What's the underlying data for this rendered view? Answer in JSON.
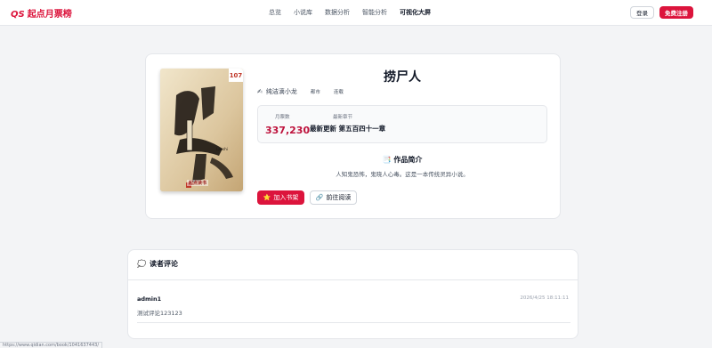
{
  "header": {
    "logo_mark": "QS",
    "logo_text": "起点月票榜",
    "nav": [
      "总览",
      "小说库",
      "数据分析",
      "智能分析",
      "可视化大屏"
    ],
    "active_nav": "可视化大屏",
    "login_label": "登录",
    "register_label": "免费注册"
  },
  "book": {
    "cover_badge": "107",
    "cover_brand": "起点读书",
    "title": "捞尸人",
    "author": "纯洁滴小龙",
    "tags": [
      "都市",
      "连载"
    ],
    "stats": {
      "votes_label": "月票数",
      "votes_value": "337,230",
      "latest_label": "最新章节",
      "latest_value": "最新更新 第五百四十一章"
    },
    "intro_title": "作品简介",
    "intro_text": "人知鬼恐怖，鬼晓人心毒。这是一本传统灵异小说。",
    "add_shelf_label": "加入书架",
    "read_label": "前往阅读"
  },
  "comments": {
    "title": "读者评论",
    "items": [
      {
        "user": "admin1",
        "time": "2026/4/25 18:11:11",
        "text": "测试评论123123"
      }
    ]
  },
  "status_url": "https://www.qidian.com/book/1041637443/",
  "colors": {
    "accent": "#dc143c",
    "votes": "#be123c"
  }
}
